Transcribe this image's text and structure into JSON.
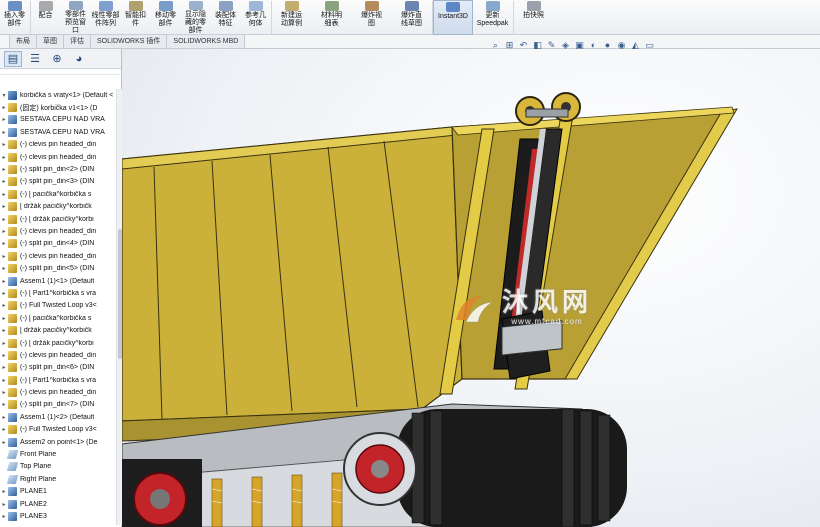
{
  "ribbon": {
    "buttons": [
      {
        "label": "插入零\n部件",
        "color": "#6b8fc4"
      },
      {
        "label": "配合",
        "color": "#a7a9ad"
      },
      {
        "label": "零部件\n预览窗\n口",
        "color": "#8fa6c3"
      },
      {
        "label": "线性零部\n件阵列",
        "color": "#7f9fd0"
      },
      {
        "label": "智能扣\n件",
        "color": "#b0a070"
      },
      {
        "label": "移动零\n部件",
        "color": "#7b9cc9"
      },
      {
        "label": "显示隐\n藏的零\n部件",
        "color": "#9ab0cf"
      },
      {
        "label": "装配体\n特征",
        "color": "#8ba2c2"
      },
      {
        "label": "参考几\n何体",
        "color": "#9fb6d6"
      },
      {
        "label": "新建运\n动算例",
        "color": "#c2ad6f"
      },
      {
        "label": "材料明\n细表",
        "color": "#8aa37f"
      },
      {
        "label": "爆炸视\n图",
        "color": "#b48c5c"
      },
      {
        "label": "爆炸直\n线草图",
        "color": "#6b86b3"
      },
      {
        "label": "Instant3D",
        "color": "#5f87c8"
      },
      {
        "label": "更新\nSpeedpak",
        "color": "#88a7cc"
      },
      {
        "label": "拍快照",
        "color": "#9aa1aa"
      }
    ]
  },
  "tabs": [
    "布局",
    "草图",
    "评估",
    "SOLIDWORKS 插件",
    "SOLIDWORKS MBD"
  ],
  "hud_icons": [
    "zoom-fit-icon",
    "zoom-area-icon",
    "previous-view-icon",
    "section-view-icon",
    "dynamic-annotation-icon",
    "view-orientation-icon",
    "display-style-icon",
    "hide-show-icon",
    "edit-appearance-icon",
    "scene-icon",
    "view-settings-icon",
    "monitor-icon"
  ],
  "panel_tabs": [
    "featuremanager-icon",
    "propertymanager-icon",
    "configurationmanager-icon",
    "appearance-icon"
  ],
  "tree": {
    "top": "korbička s vraty<1> (Default <",
    "items": [
      {
        "text": "(固定) korbička v1<1> (D",
        "icon": "part"
      },
      {
        "text": "SESTAVA ČEPU NAD VRA",
        "icon": "asm"
      },
      {
        "text": "SESTAVA ČEPU NAD VRA",
        "icon": "asm"
      },
      {
        "text": "(-) clevis pin headed_din",
        "icon": "part"
      },
      {
        "text": "(-) clevis pin headed_din",
        "icon": "part"
      },
      {
        "text": "(-) split pin_din<2> (DIN",
        "icon": "part"
      },
      {
        "text": "(-) split pin_din<3> (DIN",
        "icon": "part"
      },
      {
        "text": "(-) [ pacička^korbička s",
        "icon": "part"
      },
      {
        "text": "[ držák pacičky^korbičk",
        "icon": "part"
      },
      {
        "text": "(-) [ držák pacičky^korbi",
        "icon": "part"
      },
      {
        "text": "(-) clevis pin headed_din",
        "icon": "part"
      },
      {
        "text": "(-) split pin_din<4> (DIN",
        "icon": "part"
      },
      {
        "text": "(-) clevis pin headed_din",
        "icon": "part"
      },
      {
        "text": "(-) split pin_din<5> (DIN",
        "icon": "part"
      },
      {
        "text": "Assem1 (1)<1> (Default",
        "icon": "asm"
      },
      {
        "text": "(-) [ Part1^korbička s vra",
        "icon": "part"
      },
      {
        "text": "(-) Full Twisted Loop v3<",
        "icon": "part"
      },
      {
        "text": "(-) [ pacička^korbička s",
        "icon": "part"
      },
      {
        "text": "[ držák pacičky^korbičk",
        "icon": "part"
      },
      {
        "text": "(-) [ držák pacičky^korbi",
        "icon": "part"
      },
      {
        "text": "(-) clevis pin headed_din",
        "icon": "part"
      },
      {
        "text": "(-) split pin_din<6> (DIN",
        "icon": "part"
      },
      {
        "text": "(-) [ Part1^korbička s vra",
        "icon": "part"
      },
      {
        "text": "(-) clevis pin headed_din",
        "icon": "part"
      },
      {
        "text": "(-) split pin_din<7> (DIN",
        "icon": "part"
      },
      {
        "text": "Assem1 (1)<2> (Default",
        "icon": "asm"
      },
      {
        "text": "(-) Full Twisted Loop v3<",
        "icon": "part"
      },
      {
        "text": "Assem2 on point<1> (De",
        "icon": "asm"
      },
      {
        "text": "Front Plane",
        "icon": "plane"
      },
      {
        "text": "Top Plane",
        "icon": "plane"
      },
      {
        "text": "Right Plane",
        "icon": "plane"
      },
      {
        "text": "PLANE1",
        "icon": "asm"
      },
      {
        "text": "PLANE2",
        "icon": "asm"
      },
      {
        "text": "PLANE3",
        "icon": "asm"
      }
    ]
  },
  "watermark": {
    "cn": "沐风网",
    "url": "www.mfcad.com"
  }
}
